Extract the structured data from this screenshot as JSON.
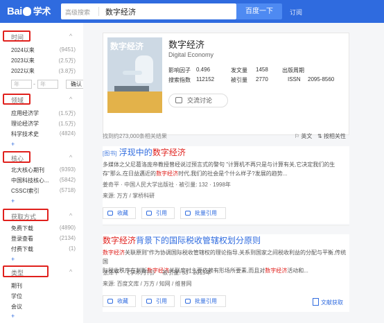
{
  "header": {
    "logo_text": "Bai",
    "logo_du": "度",
    "logo_xs": "学术",
    "search_adv": "高级搜索",
    "query": "数字经济",
    "search_button": "百度一下",
    "subscribe": "订阅"
  },
  "sidebar": {
    "time": {
      "title": "时间",
      "items": [
        {
          "label": "2024以来",
          "count": "(9451)"
        },
        {
          "label": "2023以来",
          "count": "(2.5万)"
        },
        {
          "label": "2022以来",
          "count": "(3.8万)"
        }
      ],
      "year_from": "年",
      "year_to": "年",
      "confirm": "确认"
    },
    "field": {
      "title": "领域",
      "items": [
        {
          "label": "应用经济学",
          "count": "(1.5万)"
        },
        {
          "label": "理论经济学",
          "count": "(1.5万)"
        },
        {
          "label": "科学技术史",
          "count": "(4824)"
        }
      ]
    },
    "core": {
      "title": "核心",
      "items": [
        {
          "label": "北大核心期刊",
          "count": "(9393)"
        },
        {
          "label": "中国科技核心...",
          "count": "(5842)"
        },
        {
          "label": "CSSCI索引",
          "count": "(5718)"
        }
      ]
    },
    "access": {
      "title": "获取方式",
      "items": [
        {
          "label": "免费下载",
          "count": "(4890)"
        },
        {
          "label": "登录查看",
          "count": "(2134)"
        },
        {
          "label": "付费下载",
          "count": "(1)"
        }
      ]
    },
    "type": {
      "title": "类型",
      "items": [
        {
          "label": "期刊"
        },
        {
          "label": "学位"
        },
        {
          "label": "会议"
        }
      ]
    },
    "plus": "+",
    "caret": "^"
  },
  "journal": {
    "cover_title": "数字经济",
    "title": "数字经济",
    "subtitle": "Digital Economy",
    "impact_label": "影响因子",
    "impact_value": "0.496",
    "pub_label": "发文量",
    "pub_value": "1458",
    "cycle_label": "出版周期",
    "cycle_value": "",
    "search_label": "搜索指数",
    "search_value": "112152",
    "cited_label": "被引量",
    "cited_value": "2770",
    "issn_label": "ISSN",
    "issn_value": "2095-8560",
    "discuss": "交流讨论"
  },
  "results_info": {
    "found": "找到约273,000条相关结果",
    "lang": "英文",
    "sort": "按相关性"
  },
  "results": [
    {
      "badge": "[图书]",
      "title_pre": "浮现中的",
      "title_hl": "数字经济",
      "title_post": "",
      "abstract_a": "多媒体之父尼葛洛庞帝教授曾经说过预言式的警句 \"计算机不再只是与计算有关,它决定我们的生",
      "abstract_b1": "存\"那么,在日益邁近的",
      "abstract_b_hl": "数字经济",
      "abstract_b2": "时代,我们的社会是个什么样子?发展的趋势...",
      "meta": "姜奇平 · 中国人民大学出版社 · 被引量: 132 · 1998年",
      "source": "来源: 万方 / 掌桥科研",
      "collect": "收藏",
      "cite": "引用",
      "batch": "批量引用"
    },
    {
      "badge": "",
      "title_pre": "",
      "title_hl": "数字经济",
      "title_post": "背景下的国际税收管辖权划分原则",
      "abstract_a1": "",
      "abstract_a_hl": "数字经济",
      "abstract_a2": "关联原则\"作为协调国际税收管辖权的理论指导,关系到国家之间税收利益的分配与平衡,传统国",
      "abstract_b1": "际税收秩序在判断",
      "abstract_b_hl": "数字经济",
      "abstract_b2": "关联度时主要依赖有形场所要素,而且对",
      "abstract_b_hl2": "数字经济",
      "abstract_b3": "活动和...",
      "meta": "张泽平 · 《学术月刊》 · 被引量: 53 · 2015年",
      "source": "来源: 百度文库 / 万方 / 知网 / 维普网",
      "collect": "收藏",
      "cite": "引用",
      "batch": "批量引用",
      "pdf": "文献获取"
    }
  ]
}
